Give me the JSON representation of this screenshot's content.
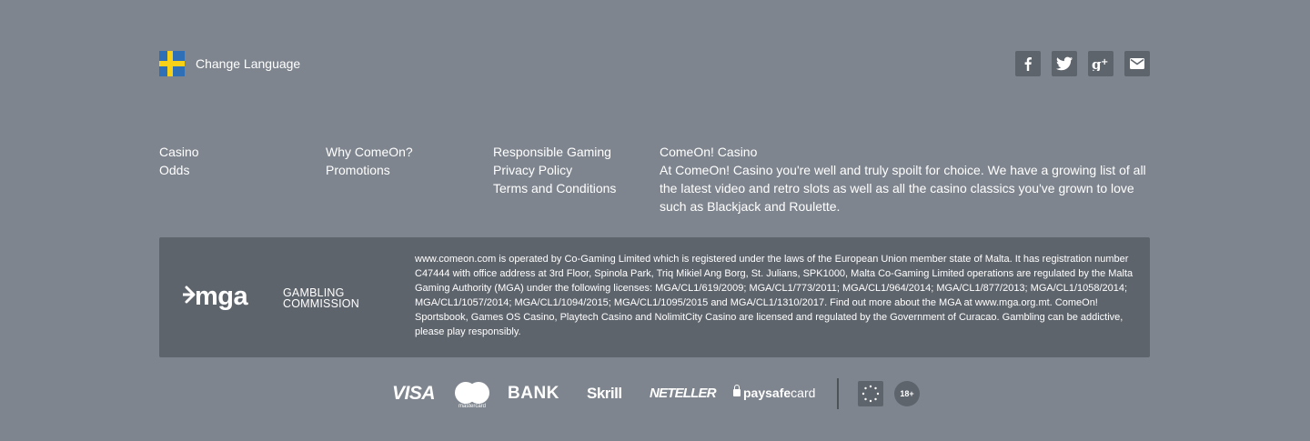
{
  "header": {
    "change_language_label": "Change Language",
    "flag_icon": "sweden-flag-icon",
    "social": [
      {
        "name": "facebook",
        "icon": "facebook-icon",
        "glyph": "f"
      },
      {
        "name": "twitter",
        "icon": "twitter-icon"
      },
      {
        "name": "google-plus",
        "icon": "google-plus-icon",
        "glyph": "g+"
      },
      {
        "name": "email",
        "icon": "mail-icon"
      }
    ]
  },
  "footer_links": {
    "col1": [
      "Casino",
      "Odds"
    ],
    "col2": [
      "Why ComeOn?",
      "Promotions"
    ],
    "col3": [
      "Responsible Gaming",
      "Privacy Policy",
      "Terms and Conditions"
    ]
  },
  "about": {
    "title": "ComeOn! Casino",
    "description": "At ComeOn! Casino you're well and truly spoilt for choice. We have a growing list of all the latest video and retro slots as well as all the casino classics you've grown to love such as Blackjack and Roulette."
  },
  "license": {
    "mga_logo_text": "mga",
    "gambling_commission_line1": "GAMBLING",
    "gambling_commission_line2": "COMMISSION",
    "text": "www.comeon.com is operated by Co-Gaming Limited which is registered under the laws of the European Union member state of Malta. It has registration number C47444 with office address at 3rd Floor, Spinola Park, Triq Mikiel Ang Borg, St. Julians, SPK1000, Malta Co-Gaming Limited operations are regulated by the Malta Gaming Authority (MGA) under the following licenses: MGA/CL1/619/2009; MGA/CL1/773/2011; MGA/CL1/964/2014; MGA/CL1/877/2013; MGA/CL1/1058/2014; MGA/CL1/1057/2014; MGA/CL1/1094/2015; MGA/CL1/1095/2015 and MGA/CL1/1310/2017. Find out more about the MGA at www.mga.org.mt. ComeOn! Sportsbook, Games OS Casino, Playtech Casino and NolimitCity Casino are licensed and regulated by the Government of Curacao. Gambling can be addictive, please play responsibly."
  },
  "payments": {
    "visa": "VISA",
    "mastercard_label": "mastercard",
    "bank": "BANK",
    "skrill": "Skrill",
    "neteller": "NETELLER",
    "paysafe_bold": "paysafe",
    "paysafe_rest": "card",
    "age_badge": "18+",
    "gamcare_icon": "gamcare-icon"
  },
  "colors": {
    "background": "#7e858e",
    "panel": "#5e646c",
    "text": "#ffffff"
  }
}
